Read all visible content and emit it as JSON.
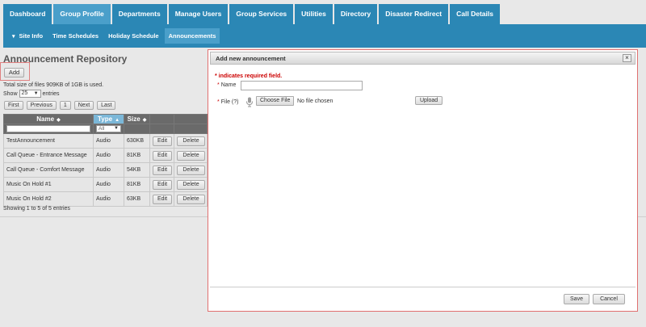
{
  "topnav": {
    "tabs": [
      {
        "label": "Dashboard"
      },
      {
        "label": "Group Profile"
      },
      {
        "label": "Departments"
      },
      {
        "label": "Manage Users"
      },
      {
        "label": "Group Services"
      },
      {
        "label": "Utilities"
      },
      {
        "label": "Directory"
      },
      {
        "label": "Disaster Redirect"
      },
      {
        "label": "Call Details"
      }
    ]
  },
  "subnav": {
    "items": [
      {
        "label": "Site Info"
      },
      {
        "label": "Time Schedules"
      },
      {
        "label": "Holiday Schedule"
      },
      {
        "label": "Announcements"
      }
    ]
  },
  "repository": {
    "title": "Announcement Repository",
    "add_label": "Add",
    "size_text": "Total size of files 909KB of 1GB is used.",
    "show_label": "Show",
    "show_value": "25",
    "entries_label": "entries",
    "pager": {
      "first": "First",
      "previous": "Previous",
      "page": "1",
      "next": "Next",
      "last": "Last"
    },
    "columns": {
      "name": "Name",
      "type": "Type",
      "size": "Size"
    },
    "type_filter_value": "All",
    "rows": [
      {
        "name": "TestAnnouncement",
        "type": "Audio",
        "size": "630KB",
        "edit": "Edit",
        "delete": "Delete"
      },
      {
        "name": "Call Queue - Entrance Message",
        "type": "Audio",
        "size": "81KB",
        "edit": "Edit",
        "delete": "Delete"
      },
      {
        "name": "Call Queue - Comfort Message",
        "type": "Audio",
        "size": "54KB",
        "edit": "Edit",
        "delete": "Delete"
      },
      {
        "name": "Music On Hold #1",
        "type": "Audio",
        "size": "81KB",
        "edit": "Edit",
        "delete": "Delete"
      },
      {
        "name": "Music On Hold #2",
        "type": "Audio",
        "size": "63KB",
        "edit": "Edit",
        "delete": "Delete"
      }
    ],
    "showing_text": "Showing 1 to 5 of 5 entries"
  },
  "dialog": {
    "title": "Add new announcement",
    "close_glyph": "×",
    "required_note": "* indicates required field.",
    "name_label": "Name",
    "file_label": "File (?)",
    "choose_file_label": "Choose File",
    "no_file_text": "No file chosen",
    "upload_label": "Upload",
    "save_label": "Save",
    "cancel_label": "Cancel",
    "required_star": "*"
  },
  "colors": {
    "nav_blue": "#2b87b5",
    "nav_active": "#4a9fca",
    "required_red": "#cc0000",
    "highlight_border": "#e07070"
  }
}
